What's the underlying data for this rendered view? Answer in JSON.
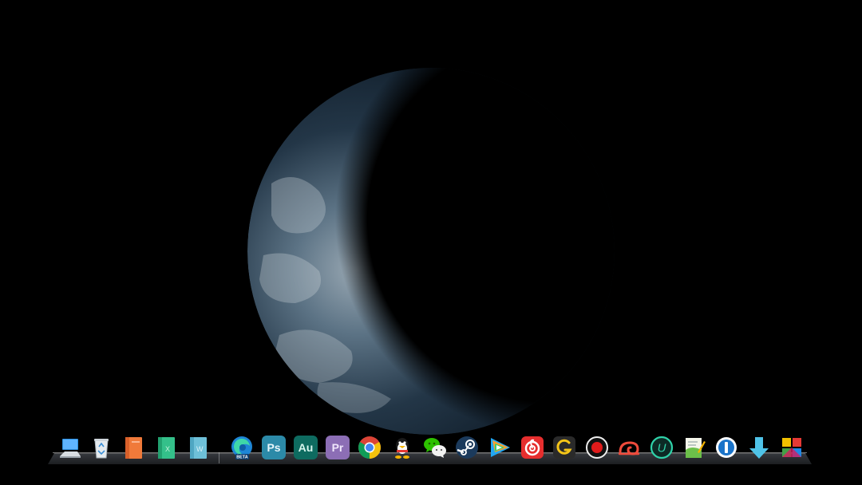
{
  "desktop": {
    "wallpaper": "earth-crescent",
    "background_color": "#000000"
  },
  "dock": {
    "items": [
      {
        "name": "this-pc",
        "icon": "computer-icon"
      },
      {
        "name": "recycle-bin",
        "icon": "recycle-bin-icon"
      },
      {
        "name": "powerpoint",
        "icon": "powerpoint-book-icon"
      },
      {
        "name": "excel",
        "icon": "excel-book-icon"
      },
      {
        "name": "word",
        "icon": "word-book-icon"
      },
      {
        "name": "edge-beta",
        "icon": "edge-beta-icon",
        "badge": "BETA"
      },
      {
        "name": "photoshop",
        "icon": "photoshop-icon",
        "label": "Ps",
        "color": "#31a8ff"
      },
      {
        "name": "audition",
        "icon": "audition-icon",
        "label": "Au",
        "color": "#00c8a0"
      },
      {
        "name": "premiere",
        "icon": "premiere-icon",
        "label": "Pr",
        "color": "#9999ff"
      },
      {
        "name": "chrome",
        "icon": "chrome-icon"
      },
      {
        "name": "qq",
        "icon": "qq-penguin-icon"
      },
      {
        "name": "wechat",
        "icon": "wechat-icon"
      },
      {
        "name": "steam",
        "icon": "steam-icon"
      },
      {
        "name": "tencent-video",
        "icon": "tencent-video-icon"
      },
      {
        "name": "netease-music",
        "icon": "netease-music-icon"
      },
      {
        "name": "app-g",
        "icon": "g-logo-icon"
      },
      {
        "name": "screen-recorder",
        "icon": "record-icon"
      },
      {
        "name": "snail-app",
        "icon": "snail-icon"
      },
      {
        "name": "u-app",
        "icon": "u-circle-icon",
        "label": "U"
      },
      {
        "name": "notepad",
        "icon": "notepad-icon"
      },
      {
        "name": "one-password",
        "icon": "1password-icon",
        "label": "1"
      },
      {
        "name": "downloader",
        "icon": "download-arrow-icon"
      },
      {
        "name": "tile-app",
        "icon": "colored-tiles-icon"
      }
    ]
  }
}
